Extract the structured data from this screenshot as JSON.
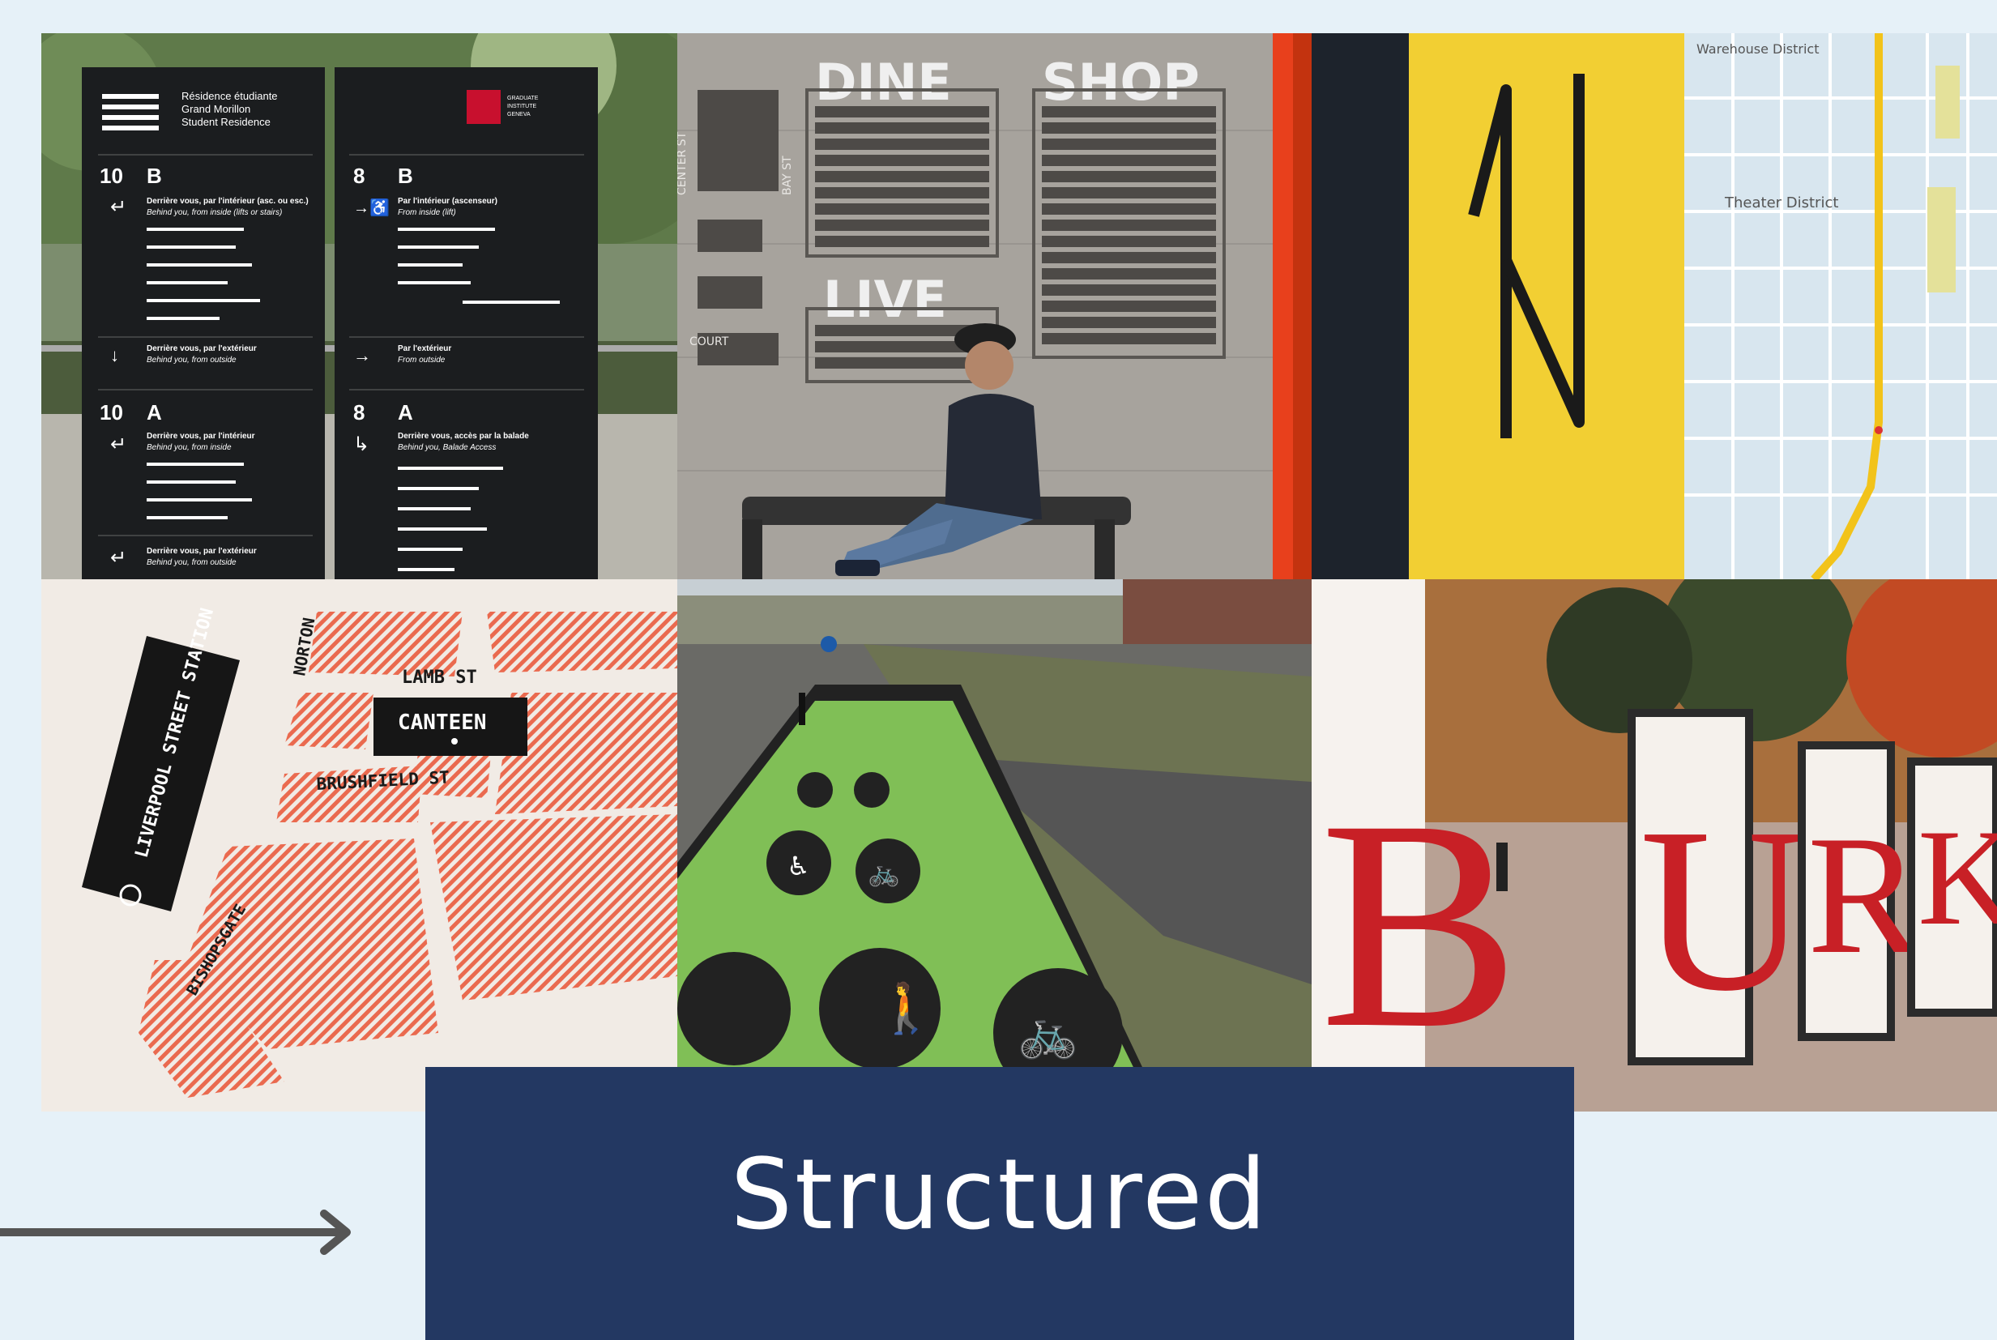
{
  "collage": {
    "signs": {
      "left_header": [
        "Résidence étudiante",
        "Grand Morillon",
        "Student Residence"
      ],
      "right_logo": [
        "GRADUATE",
        "INSTITUTE",
        "GENEVA"
      ],
      "addr_left": "10",
      "addr_right": "8",
      "entry_top": "B",
      "entry_bottom": "A",
      "left_top_head": "Derrière vous, par l'intérieur (asc. ou esc.)",
      "left_top_sub": "Behind you, from inside (lifts or stairs)",
      "right_top_head": "Par l'intérieur (ascenseur)",
      "right_top_sub": "From inside (lift)",
      "left_outside_head": "Derrière vous, par l'extérieur",
      "left_outside_sub": "Behind you, from outside",
      "right_outside_head": "Par l'extérieur",
      "right_outside_sub": "From outside",
      "left_inside_head": "Derrière vous, par l'intérieur",
      "left_inside_sub": "Behind you, from inside",
      "right_balade_head": "Derrière vous, accès par la balade",
      "right_balade_sub": "Behind you, Balade Access",
      "left_bottom_head": "Derrière vous, par l'extérieur",
      "left_bottom_sub": "Behind you, from outside"
    },
    "dine": {
      "dine": "DINE",
      "shop": "SHOP",
      "live": "LIVE",
      "center_st": "CENTER ST",
      "bay_st": "BAY ST",
      "court": "COURT"
    },
    "map": {
      "warehouse": "Warehouse District",
      "theater": "Theater District"
    },
    "london": {
      "lamb": "LAMB ST",
      "canteen": "CANTEEN",
      "brushfield": "BRUSHFIELD ST",
      "norton": "NORTON",
      "liverpool": "LIVERPOOL STREET STATION",
      "bishopsgate": "BISHOPSGATE"
    },
    "burke": {
      "letters": [
        "B",
        "U",
        "R",
        "K"
      ]
    }
  },
  "label": {
    "text": "Structured"
  },
  "colors": {
    "background": "#e6f1f8",
    "label_box": "#233862",
    "arrow": "#555555"
  }
}
